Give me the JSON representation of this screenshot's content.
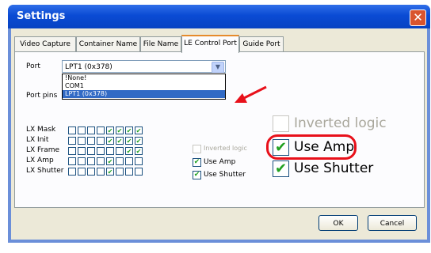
{
  "window": {
    "title": "Settings",
    "close_glyph": "✕"
  },
  "tabs": [
    {
      "label": "Video Capture"
    },
    {
      "label": "Container Name"
    },
    {
      "label": "File Name"
    },
    {
      "label": "LE Control Port"
    },
    {
      "label": "Guide Port"
    }
  ],
  "active_tab": "LE Control Port",
  "port": {
    "label": "Port",
    "value": "LPT1 (0x378)",
    "options": [
      "!None!",
      "COM1",
      "LPT1 (0x378)"
    ],
    "selected_index": 2
  },
  "port_pins_label": "Port pins",
  "pin_rows": [
    {
      "label": "LX Mask",
      "checked": [
        0,
        0,
        0,
        0,
        1,
        1,
        1,
        1
      ]
    },
    {
      "label": "LX Init",
      "checked": [
        0,
        0,
        0,
        0,
        1,
        1,
        1,
        1
      ]
    },
    {
      "label": "LX Frame",
      "checked": [
        0,
        0,
        0,
        0,
        0,
        0,
        1,
        1
      ]
    },
    {
      "label": "LX Amp",
      "checked": [
        0,
        0,
        0,
        0,
        1,
        0,
        0,
        0
      ]
    },
    {
      "label": "LX Shutter",
      "checked": [
        0,
        0,
        0,
        0,
        1,
        0,
        0,
        0
      ]
    }
  ],
  "options": {
    "inverted_logic": {
      "label": "Inverted logic",
      "checked": false,
      "disabled": true
    },
    "use_amp": {
      "label": "Use Amp",
      "checked": true
    },
    "use_shutter": {
      "label": "Use Shutter",
      "checked": true
    }
  },
  "zoom": {
    "inverted_logic": "Inverted logic",
    "use_amp": "Use Amp",
    "use_shutter": "Use Shutter"
  },
  "buttons": {
    "ok": "OK",
    "cancel": "Cancel"
  },
  "annotation": {
    "arrow_color": "#e8101a",
    "highlight_color": "#e8101a"
  },
  "check_glyph": "✔",
  "dropdown_glyph": "▼"
}
